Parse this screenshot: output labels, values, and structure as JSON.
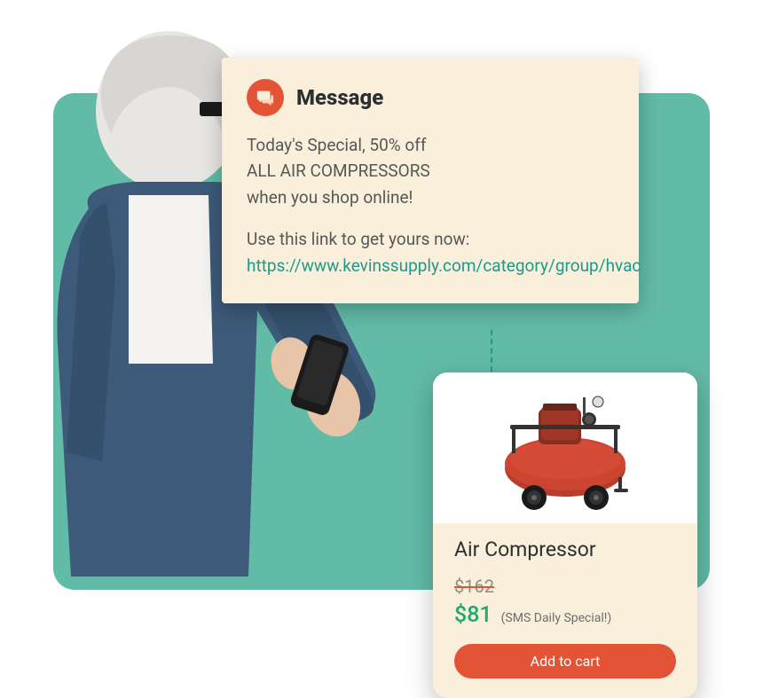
{
  "message": {
    "title": "Message",
    "body_line1": "Today's Special, 50% off",
    "body_line2": "ALL AIR COMPRESSORS",
    "body_line3": "when you shop online!",
    "cta_text": "Use this link to get yours now:",
    "link_text": "https://www.kevinssupply.com/category/group/hvac"
  },
  "product": {
    "name": "Air Compressor",
    "price_old": "$162",
    "price_new": "$81",
    "price_note": "(SMS Daily Special!)",
    "button_label": "Add to cart"
  },
  "colors": {
    "accent": "#e35336",
    "teal": "#1f9a8a",
    "green_bg": "#62bba7",
    "cream": "#faefda",
    "price_green": "#22a86f"
  }
}
